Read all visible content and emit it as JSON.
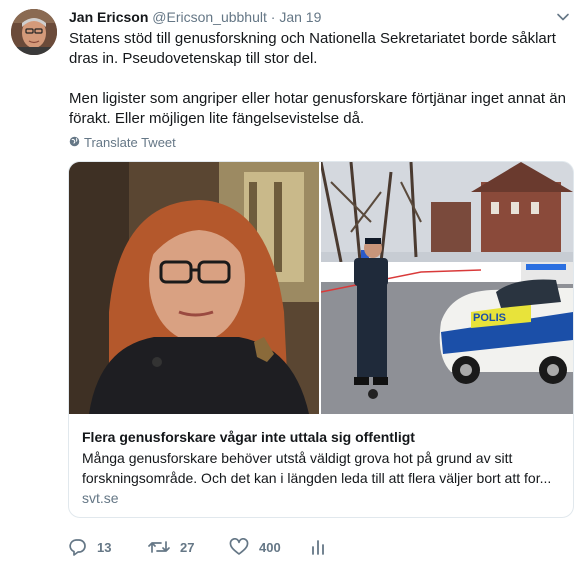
{
  "author": {
    "name": "Jan Ericson",
    "handle": "@Ericson_ubbhult",
    "separator": "·",
    "date": "Jan 19"
  },
  "tweet": {
    "paragraph1": "Statens stöd till genusforskning och Nationella Sekretariatet borde såklart dras in. Pseudovetenskap till stor del.",
    "paragraph2": "Men ligister som angriper eller hotar genusforskare förtjänar inget annat än förakt. Eller möjligen lite fängelsevistelse då."
  },
  "translate_label": "Translate Tweet",
  "card": {
    "title": "Flera genusforskare vågar inte uttala sig offentligt",
    "description": "Många genusforskare behöver utstå väldigt grova hot på grund av sitt forskningsområde. Och det kan i längden leda till att flera väljer bort att for...",
    "domain": "svt.se",
    "police_car_text": "POLIS"
  },
  "actions": {
    "replies": "13",
    "retweets": "27",
    "likes": "400"
  },
  "colors": {
    "text": "#14171a",
    "secondary": "#657786",
    "border": "#e1e8ed",
    "police_blue": "#1b4fa8",
    "police_yellow": "#e8e33a"
  },
  "icons": [
    "chevron-down-icon",
    "globe-icon",
    "reply-icon",
    "retweet-icon",
    "like-icon",
    "analytics-icon"
  ]
}
